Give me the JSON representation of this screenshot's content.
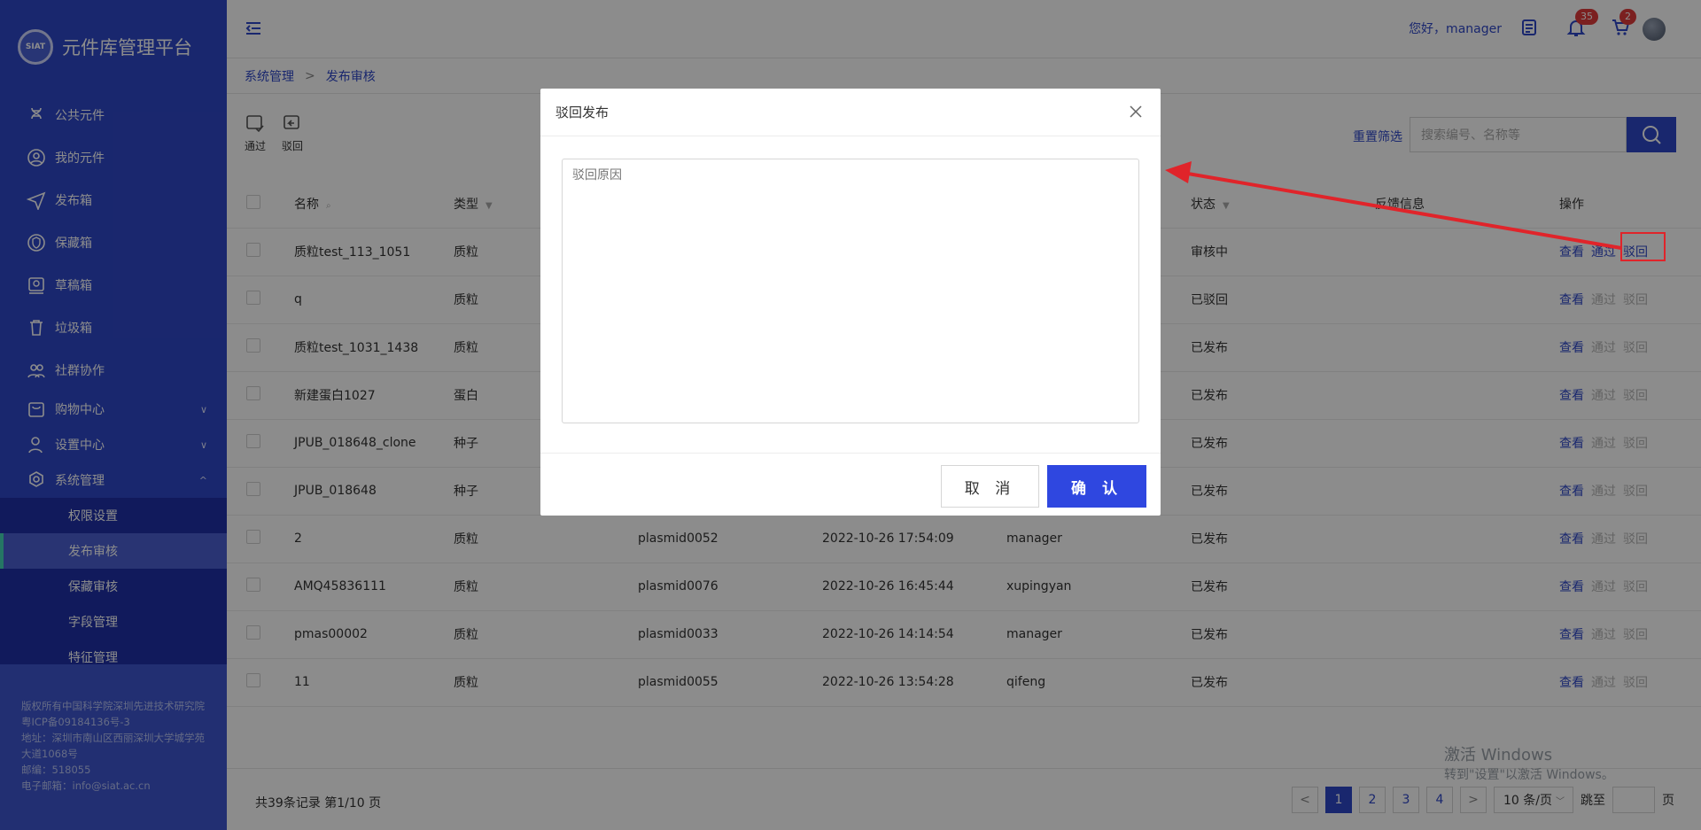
{
  "app": {
    "title": "元件库管理平台",
    "logo_text": "SIAT"
  },
  "sidebar": {
    "items": [
      {
        "label": "公共元件",
        "icon": "dna-icon"
      },
      {
        "label": "我的元件",
        "icon": "user-circle-icon"
      },
      {
        "label": "发布箱",
        "icon": "send-icon"
      },
      {
        "label": "保藏箱",
        "icon": "shield-icon"
      },
      {
        "label": "草稿箱",
        "icon": "draft-icon"
      },
      {
        "label": "垃圾箱",
        "icon": "trash-icon"
      },
      {
        "label": "社群协作",
        "icon": "group-icon"
      },
      {
        "label": "购物中心",
        "icon": "cart-box-icon"
      },
      {
        "label": "设置中心",
        "icon": "user-settings-icon"
      },
      {
        "label": "系统管理",
        "icon": "gear-icon"
      }
    ],
    "submenu": [
      "权限设置",
      "发布审核",
      "保藏审核",
      "字段管理",
      "特征管理"
    ],
    "active_sub": "发布审核",
    "copyright": [
      "版权所有中国科学院深圳先进技术研究院 粤ICP备09184136号-3",
      "地址：深圳市南山区西丽深圳大学城学苑大道1068号",
      "邮编：518055",
      "电子邮箱：info@siat.ac.cn"
    ]
  },
  "topbar": {
    "greeting": "您好，manager",
    "notif_count": "35",
    "cart_count": "2"
  },
  "breadcrumb": {
    "parent": "系统管理",
    "sep": ">",
    "current": "发布审核"
  },
  "toolbar": {
    "pass_label": "通过",
    "reject_label": "驳回",
    "reset_label": "重置筛选",
    "search_placeholder": "搜索编号、名称等"
  },
  "table": {
    "headers": {
      "name": "名称",
      "type": "类型",
      "status": "状态",
      "feedback": "反馈信息",
      "ops": "操作"
    },
    "rows": [
      {
        "name": "质粒test_113_1051",
        "type": "质粒",
        "code": "",
        "time": "",
        "user": "",
        "status": "审核中",
        "status_kind": "review"
      },
      {
        "name": "q",
        "type": "质粒",
        "code": "",
        "time": "",
        "user": "",
        "status": "已驳回",
        "status_kind": "reject"
      },
      {
        "name": "质粒test_1031_1438",
        "type": "质粒",
        "code": "",
        "time": "",
        "user": "",
        "status": "已发布",
        "status_kind": "pub"
      },
      {
        "name": "新建蛋白1027",
        "type": "蛋白",
        "code": "",
        "time": "",
        "user": "",
        "status": "已发布",
        "status_kind": "pub"
      },
      {
        "name": "JPUB_018648_clone",
        "type": "种子",
        "code": "",
        "time": "",
        "user": "",
        "status": "已发布",
        "status_kind": "pub"
      },
      {
        "name": "JPUB_018648",
        "type": "种子",
        "code": "",
        "time": "",
        "user": "",
        "status": "已发布",
        "status_kind": "pub"
      },
      {
        "name": "2",
        "type": "质粒",
        "code": "plasmid0052",
        "time": "2022-10-26 17:54:09",
        "user": "manager",
        "status": "已发布",
        "status_kind": "pub"
      },
      {
        "name": "AMQ45836111",
        "type": "质粒",
        "code": "plasmid0076",
        "time": "2022-10-26 16:45:44",
        "user": "xupingyan",
        "status": "已发布",
        "status_kind": "pub"
      },
      {
        "name": "pmas00002",
        "type": "质粒",
        "code": "plasmid0033",
        "time": "2022-10-26 14:14:54",
        "user": "manager",
        "status": "已发布",
        "status_kind": "pub"
      },
      {
        "name": "11",
        "type": "质粒",
        "code": "plasmid0055",
        "time": "2022-10-26 13:54:28",
        "user": "qifeng",
        "status": "已发布",
        "status_kind": "pub"
      }
    ],
    "ops": {
      "view": "查看",
      "pass": "通过",
      "reject": "驳回"
    }
  },
  "footer": {
    "summary": "共39条记录 第1/10 页",
    "pages": [
      "1",
      "2",
      "3",
      "4"
    ],
    "prev": "<",
    "next": ">",
    "page_size": "10 条/页",
    "jump_label": "跳至",
    "page_suffix": "页"
  },
  "watermark": {
    "line1": "激活 Windows",
    "line2": "转到\"设置\"以激活 Windows。"
  },
  "modal": {
    "title": "驳回发布",
    "placeholder": "驳回原因",
    "cancel": "取 消",
    "confirm": "确 认"
  },
  "colors": {
    "primary": "#2f47c8",
    "review": "#e8621b",
    "reject": "#e03b3b",
    "published": "#1aa84b",
    "annotation": "#e0242a"
  }
}
